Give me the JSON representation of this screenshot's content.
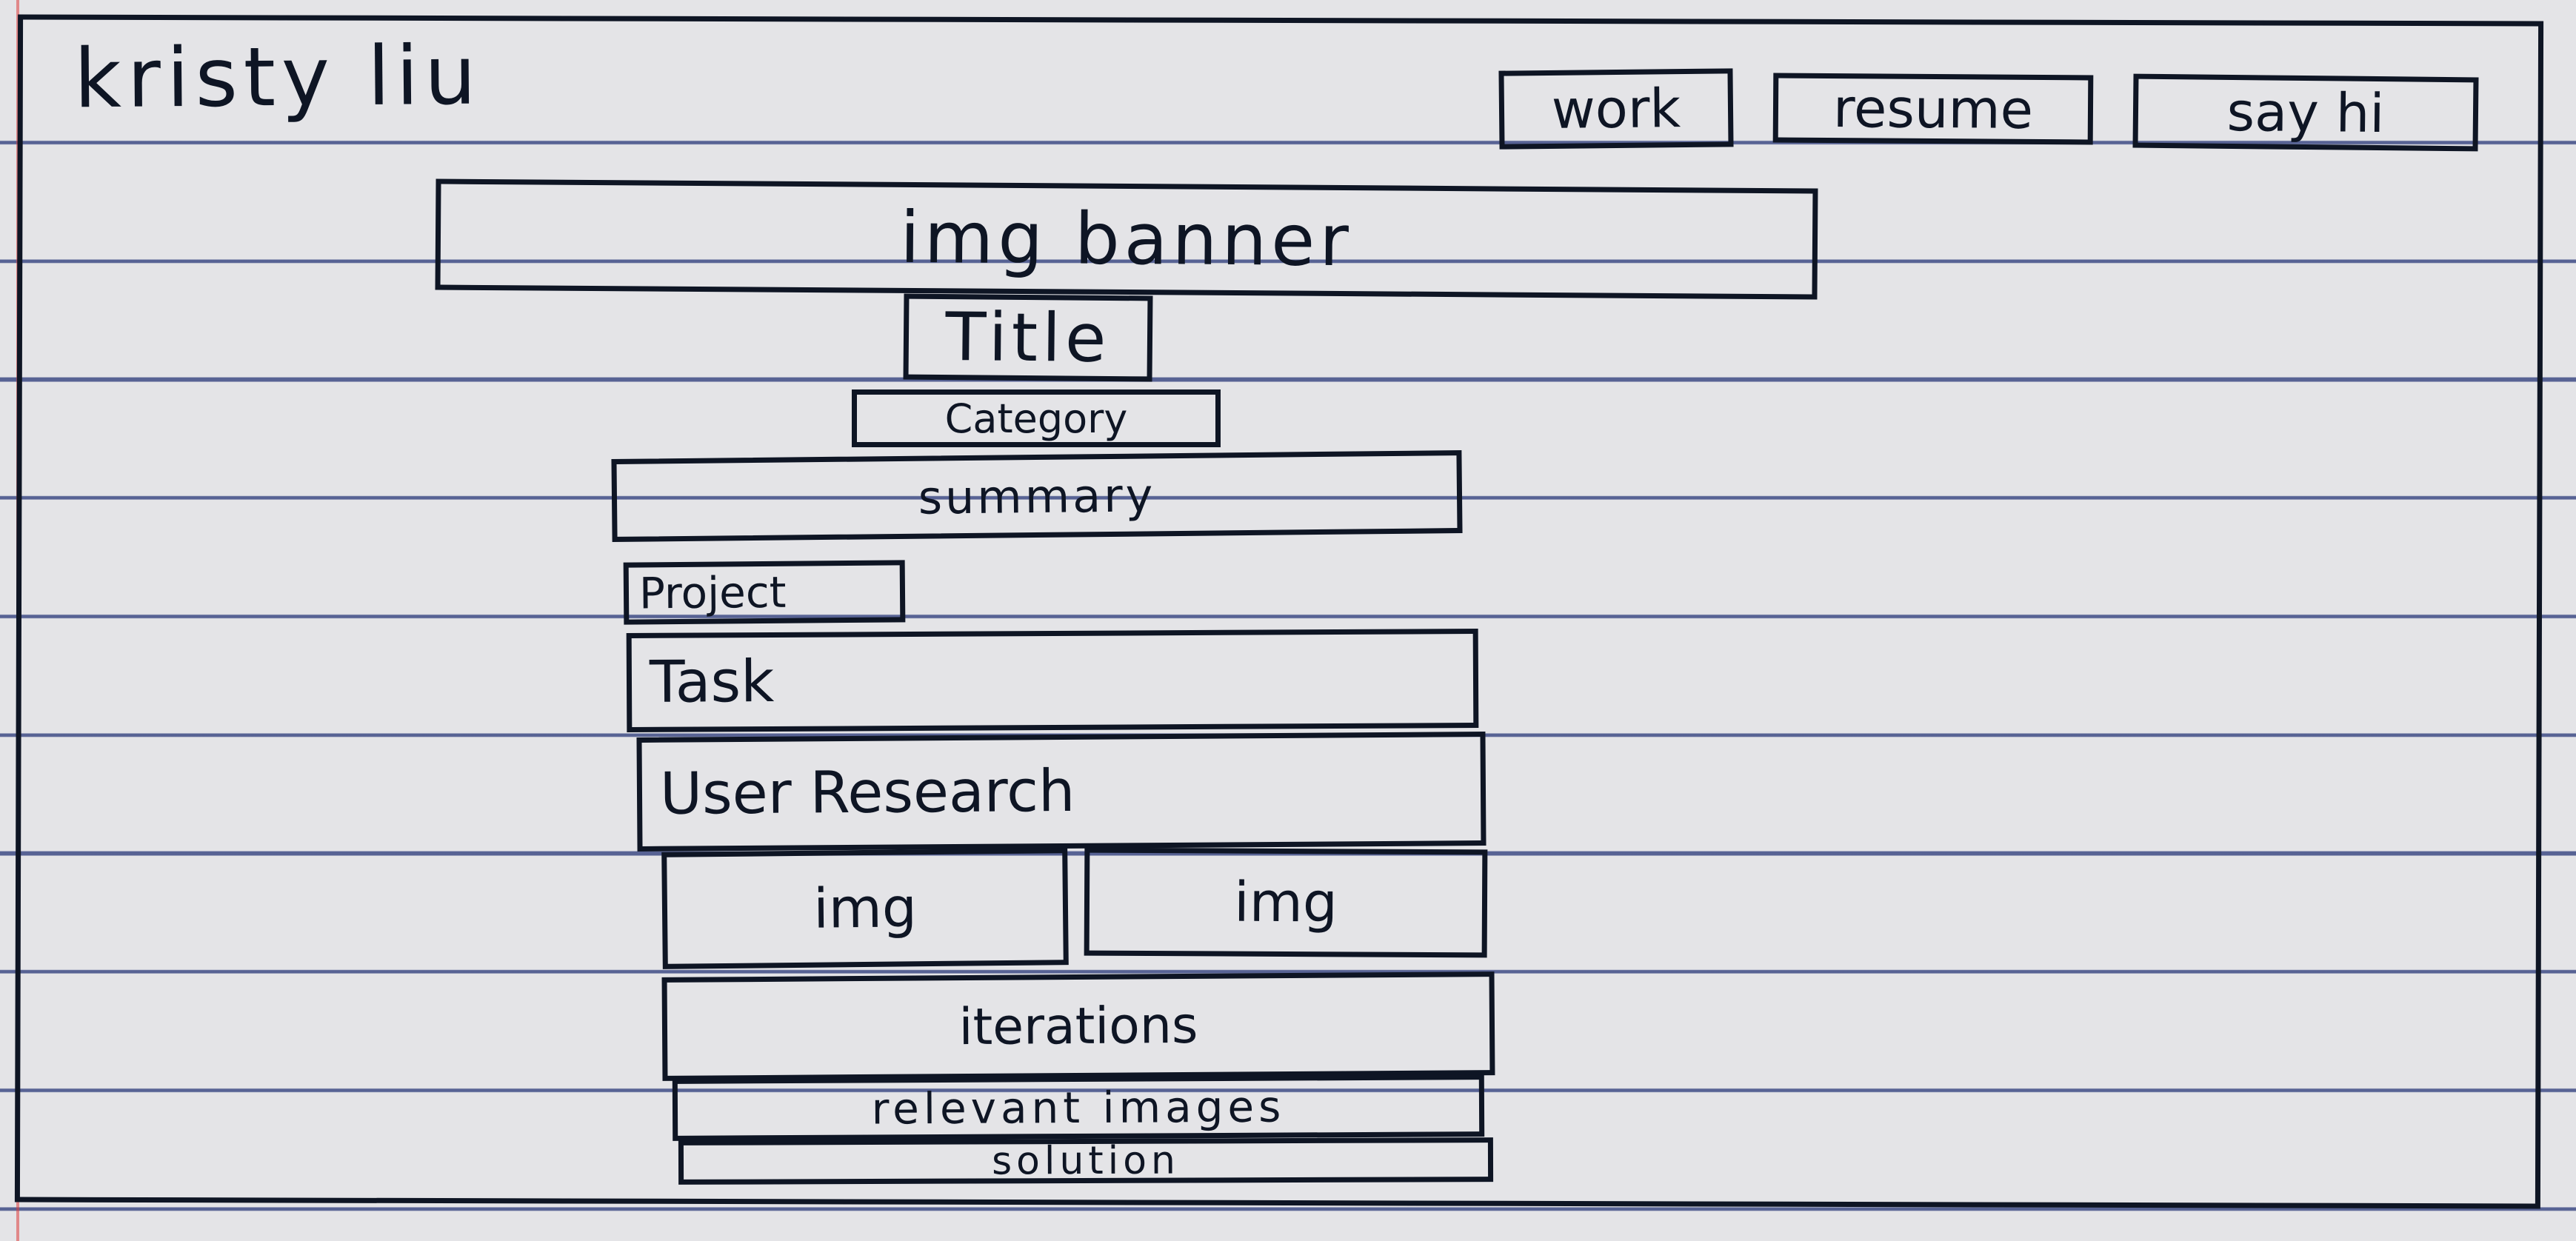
{
  "site": {
    "logo": "kristy liu"
  },
  "nav": {
    "work": "work",
    "resume": "resume",
    "say_hi": "say hi"
  },
  "sections": {
    "banner": "img banner",
    "title": "Title",
    "category": "Category",
    "summary": "summary",
    "project": "Project",
    "task": "Task",
    "user_research": "User Research",
    "img_left": "img",
    "img_right": "img",
    "iterations": "iterations",
    "relevant_images": "relevant images",
    "solution": "solution"
  }
}
